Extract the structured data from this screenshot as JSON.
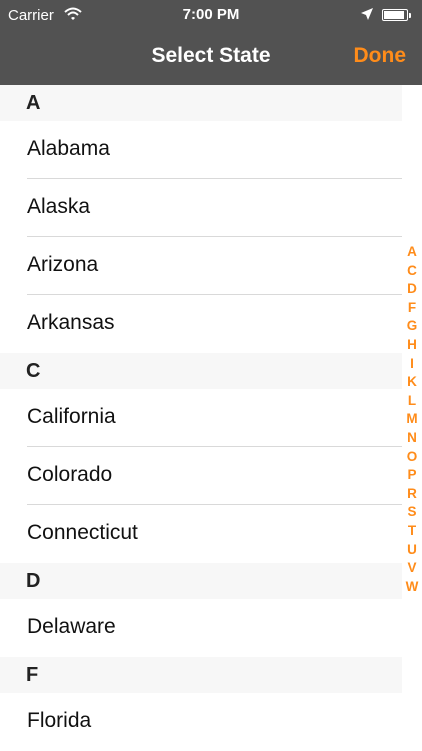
{
  "status_bar": {
    "carrier": "Carrier",
    "time": "7:00 PM",
    "icons": [
      "wifi-icon",
      "location-arrow-icon",
      "battery-icon"
    ]
  },
  "nav": {
    "title": "Select State",
    "done_label": "Done",
    "accent_color": "#ff8c1a",
    "bar_color": "#525252"
  },
  "sections": [
    {
      "letter": "A",
      "states": [
        "Alabama",
        "Alaska",
        "Arizona",
        "Arkansas"
      ]
    },
    {
      "letter": "C",
      "states": [
        "California",
        "Colorado",
        "Connecticut"
      ]
    },
    {
      "letter": "D",
      "states": [
        "Delaware"
      ]
    },
    {
      "letter": "F",
      "states": [
        "Florida"
      ]
    }
  ],
  "index": [
    "A",
    "C",
    "D",
    "F",
    "G",
    "H",
    "I",
    "K",
    "L",
    "M",
    "N",
    "O",
    "P",
    "R",
    "S",
    "T",
    "U",
    "V",
    "W"
  ]
}
